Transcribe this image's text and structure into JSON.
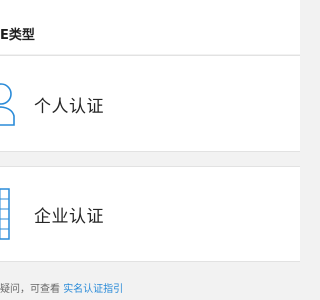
{
  "header": {
    "section_title": "E类型"
  },
  "cards": {
    "personal": {
      "label": "个人认证",
      "icon": "person-icon"
    },
    "enterprise": {
      "label": "企业认证",
      "icon": "building-icon"
    }
  },
  "footer": {
    "text": "疑问，可查看 ",
    "link_label": "实名认证指引"
  },
  "colors": {
    "accent": "#2a8bd8",
    "page_background": "#f2f2f2",
    "card_background": "#ffffff"
  }
}
